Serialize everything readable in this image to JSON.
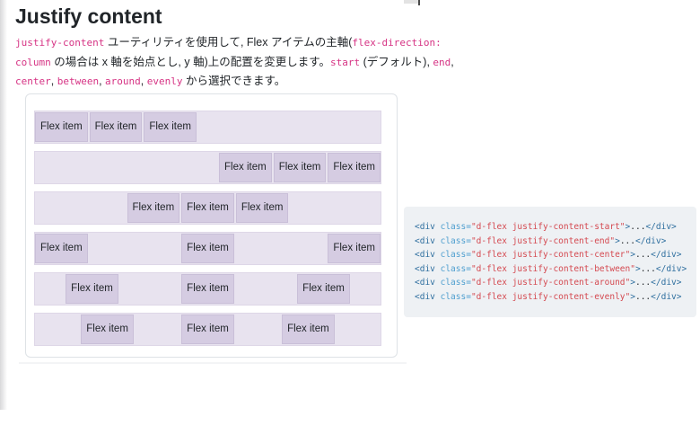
{
  "title": "Justify content",
  "intro": {
    "lines": [
      {
        "segments": [
          {
            "t": "code",
            "v": "justify-content"
          },
          {
            "t": "text",
            "v": " ユーティリティを使用して, Flex アイテムの主軸("
          },
          {
            "t": "code",
            "v": "flex-direction:"
          }
        ]
      },
      {
        "segments": [
          {
            "t": "code",
            "v": "column"
          },
          {
            "t": "text",
            "v": " の場合は x 軸を始点とし, y 軸)上の配置を変更します。"
          },
          {
            "t": "code",
            "v": "start"
          },
          {
            "t": "text",
            "v": " (デフォルト), "
          },
          {
            "t": "code",
            "v": "end"
          },
          {
            "t": "text",
            "v": ","
          }
        ]
      },
      {
        "segments": [
          {
            "t": "code",
            "v": "center"
          },
          {
            "t": "text",
            "v": ", "
          },
          {
            "t": "code",
            "v": "between"
          },
          {
            "t": "text",
            "v": ", "
          },
          {
            "t": "code",
            "v": "around"
          },
          {
            "t": "text",
            "v": ", "
          },
          {
            "t": "code",
            "v": "evenly"
          },
          {
            "t": "text",
            "v": " から選択できます。"
          }
        ]
      }
    ]
  },
  "example": {
    "item_label": "Flex item",
    "items_per_row": 3,
    "rows": [
      {
        "name": "justify-content-start",
        "justify": "flex-start"
      },
      {
        "name": "justify-content-end",
        "justify": "flex-end"
      },
      {
        "name": "justify-content-center",
        "justify": "center"
      },
      {
        "name": "justify-content-between",
        "justify": "space-between"
      },
      {
        "name": "justify-content-around",
        "justify": "space-around"
      },
      {
        "name": "justify-content-evenly",
        "justify": "space-evenly"
      }
    ]
  },
  "code": {
    "lines": [
      {
        "parts": [
          {
            "s": "tag",
            "v": "<div "
          },
          {
            "s": "attr",
            "v": "class="
          },
          {
            "s": "str",
            "v": "\"d-flex justify-content-start\""
          },
          {
            "s": "tag",
            "v": ">"
          },
          {
            "s": "plain",
            "v": "..."
          },
          {
            "s": "tag",
            "v": "</div>"
          }
        ]
      },
      {
        "parts": [
          {
            "s": "tag",
            "v": "<div "
          },
          {
            "s": "attr",
            "v": "class="
          },
          {
            "s": "str",
            "v": "\"d-flex justify-content-end\""
          },
          {
            "s": "tag",
            "v": ">"
          },
          {
            "s": "plain",
            "v": "..."
          },
          {
            "s": "tag",
            "v": "</div>"
          }
        ]
      },
      {
        "parts": [
          {
            "s": "tag",
            "v": "<div "
          },
          {
            "s": "attr",
            "v": "class="
          },
          {
            "s": "str",
            "v": "\"d-flex justify-content-center\""
          },
          {
            "s": "tag",
            "v": ">"
          },
          {
            "s": "plain",
            "v": "..."
          },
          {
            "s": "tag",
            "v": "</div>"
          }
        ]
      },
      {
        "parts": [
          {
            "s": "tag",
            "v": "<div "
          },
          {
            "s": "attr",
            "v": "class="
          },
          {
            "s": "str",
            "v": "\"d-flex justify-content-between\""
          },
          {
            "s": "tag",
            "v": ">"
          },
          {
            "s": "plain",
            "v": "..."
          },
          {
            "s": "tag",
            "v": "</div>"
          }
        ]
      },
      {
        "parts": [
          {
            "s": "tag",
            "v": "<div "
          },
          {
            "s": "attr",
            "v": "class="
          },
          {
            "s": "str",
            "v": "\"d-flex justify-content-around\""
          },
          {
            "s": "tag",
            "v": ">"
          },
          {
            "s": "plain",
            "v": "..."
          },
          {
            "s": "tag",
            "v": "</div>"
          }
        ]
      },
      {
        "parts": [
          {
            "s": "tag",
            "v": "<div "
          },
          {
            "s": "attr",
            "v": "class="
          },
          {
            "s": "str",
            "v": "\"d-flex justify-content-evenly\""
          },
          {
            "s": "tag",
            "v": ">"
          },
          {
            "s": "plain",
            "v": "..."
          },
          {
            "s": "tag",
            "v": "</div>"
          }
        ]
      }
    ]
  },
  "colors": {
    "body_text": "#212529",
    "inline_code": "#d63384",
    "code_tag": "#2f6f9f",
    "code_attr": "#4f9fcf",
    "code_string": "#d44950",
    "highlight_container_bg": "#e8e3ef",
    "highlight_item_bg": "#d5cce2",
    "card_border": "#dee2e6",
    "code_block_bg": "#eef1f4"
  }
}
